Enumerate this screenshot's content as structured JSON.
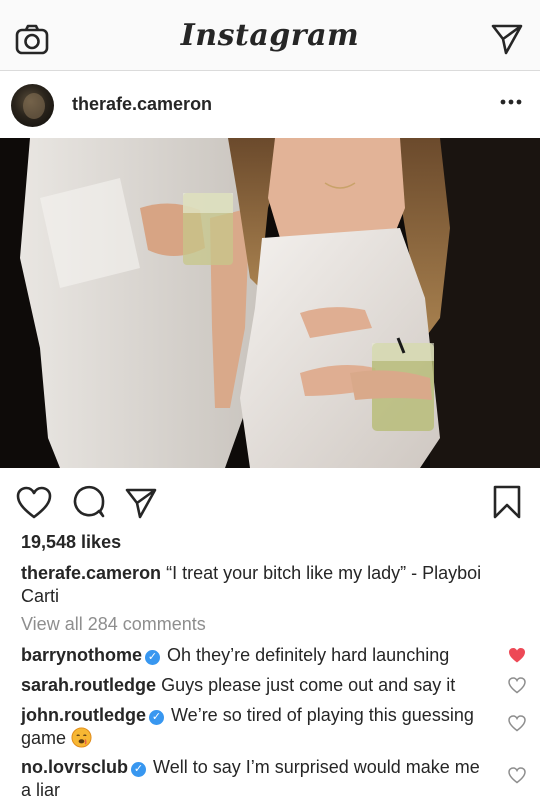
{
  "header": {
    "title": "Instagram",
    "camera_icon": "camera-icon",
    "direct_icon": "paper-plane-icon"
  },
  "post": {
    "username": "therafe.cameron",
    "more_icon": "more-dots-icon",
    "likes": "19,548 likes",
    "caption_user": "therafe.cameron",
    "caption_text": "“I treat your bitch like my lady” - Playboi Carti",
    "view_all": "View all 284 comments",
    "comments": [
      {
        "user": "barrynothome",
        "verified": true,
        "text": "Oh they’re definitely hard launching",
        "liked": true
      },
      {
        "user": "sarah.routledge",
        "verified": false,
        "text": "Guys please just come out and say it",
        "liked": false
      },
      {
        "user": "john.routledge",
        "verified": true,
        "text": "We’re so tired of playing this guessing game",
        "liked": false,
        "emoji": "hot-face-emoji"
      },
      {
        "user": "no.lovrsclub",
        "verified": true,
        "text": "Well to say I’m surprised would make me a liar",
        "liked": false
      }
    ]
  },
  "colors": {
    "accent_blue": "#3897f0",
    "like_red": "#ed4956",
    "text": "#262626",
    "muted": "#8e8e8e"
  }
}
